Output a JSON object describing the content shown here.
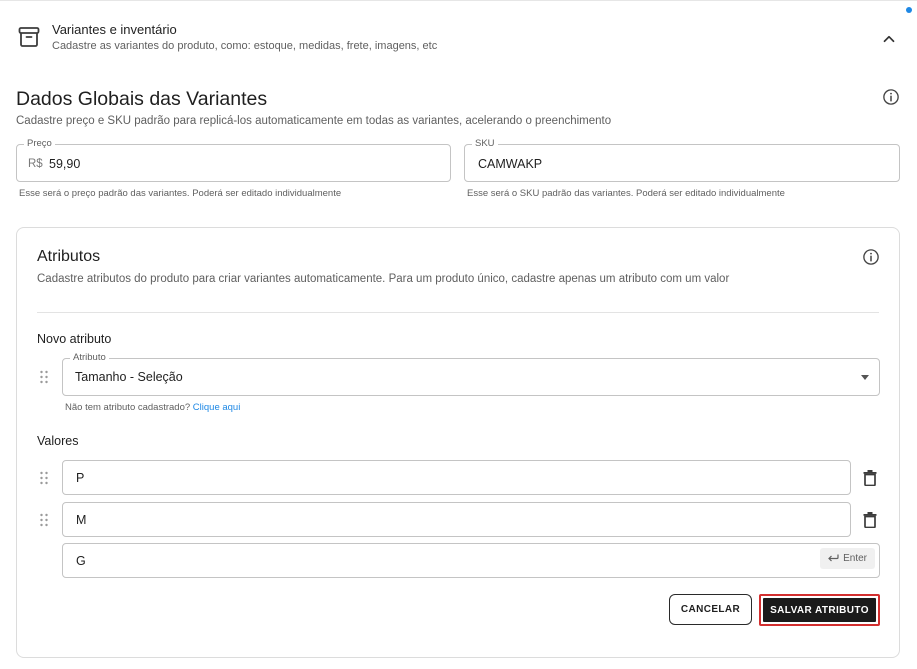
{
  "section": {
    "title": "Variantes e inventário",
    "subtitle": "Cadastre as variantes do produto, como: estoque, medidas, frete, imagens, etc"
  },
  "global": {
    "title": "Dados Globais das Variantes",
    "subtitle": "Cadastre preço e SKU padrão para replicá-los automaticamente em todas as variantes, acelerando o preenchimento",
    "price": {
      "label": "Preço",
      "prefix": "R$",
      "value": "59,90",
      "helper": "Esse será o preço padrão das variantes. Poderá ser editado individualmente"
    },
    "sku": {
      "label": "SKU",
      "value": "CAMWAKP",
      "helper": "Esse será o SKU padrão das variantes. Poderá ser editado individualmente"
    }
  },
  "attributes": {
    "title": "Atributos",
    "subtitle": "Cadastre atributos do produto para criar variantes automaticamente. Para um produto único, cadastre apenas um atributo com um valor",
    "new_attribute_label": "Novo atributo",
    "select": {
      "label": "Atributo",
      "value": "Tamanho - Seleção"
    },
    "hint_text": "Não tem atributo cadastrado?",
    "hint_link": "Clique aqui",
    "values_label": "Valores",
    "values": [
      "P",
      "M"
    ],
    "new_value": "G",
    "enter_chip": "Enter",
    "cancel_label": "CANCELAR",
    "save_label": "SALVAR ATRIBUTO"
  },
  "colors": {
    "accent": "#1e88e5",
    "save_button": "#1b1b1b",
    "highlight": "#d32f2f"
  },
  "icons": [
    "archive-box-icon",
    "chevron-up-icon",
    "info-icon",
    "drag-handle-icon",
    "trash-icon",
    "enter-return-icon",
    "dropdown-caret-icon"
  ]
}
